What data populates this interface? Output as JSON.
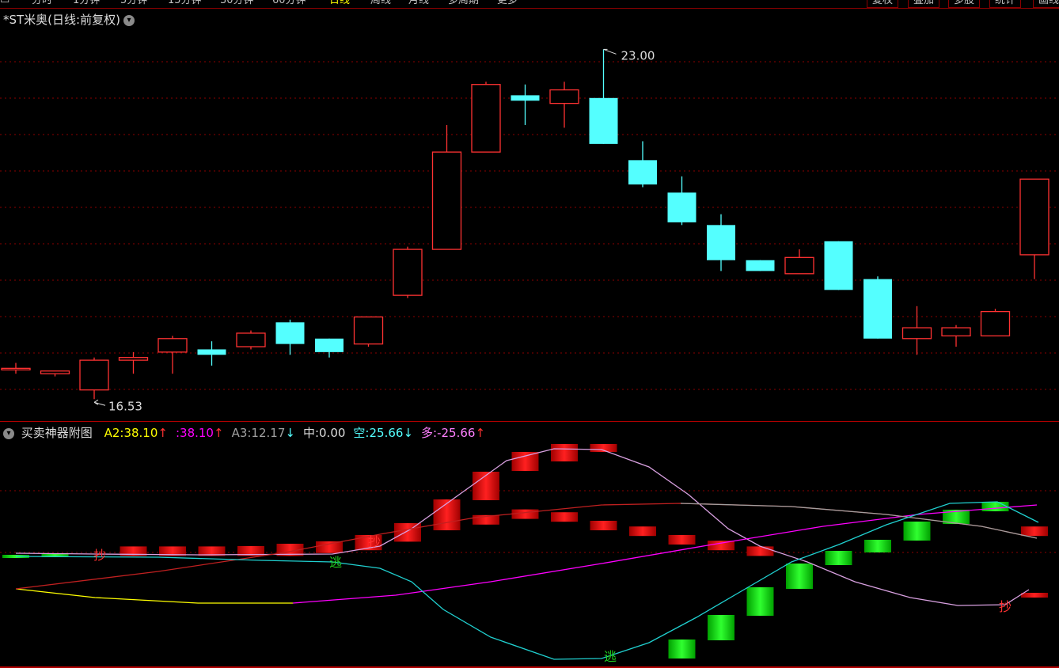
{
  "toolbar": {
    "periods": [
      "分时",
      "1分钟",
      "5分钟",
      "15分钟",
      "30分钟",
      "60分钟",
      "日线",
      "周线",
      "月线",
      "多周期",
      "更多"
    ],
    "active_period": "日线",
    "buttons": [
      "复权",
      "叠加",
      "多股",
      "统计",
      "画线"
    ]
  },
  "main_chart": {
    "title": "*ST米奥(日线:前复权)",
    "high_label": "23.00",
    "low_label": "16.53",
    "colors": {
      "up": "#ff3232",
      "down": "#54ffff",
      "grid": "#8b0000"
    }
  },
  "indicator": {
    "name": "买卖神器附图",
    "items": [
      {
        "label": "A2:",
        "value": "38.10",
        "arrow": "↑",
        "label_color": "#ffff00",
        "value_color": "#ffff00",
        "arrow_color": "#ff3232"
      },
      {
        "label": ":",
        "value": "38.10",
        "arrow": "↑",
        "label_color": "#ff00ff",
        "value_color": "#ff00ff",
        "arrow_color": "#ff3232"
      },
      {
        "label": "A3:",
        "value": "12.17",
        "arrow": "↓",
        "label_color": "#a0a0a0",
        "value_color": "#a0a0a0",
        "arrow_color": "#54ffff"
      },
      {
        "label": "中:",
        "value": "0.00",
        "arrow": "",
        "label_color": "#dcdcdc",
        "value_color": "#dcdcdc",
        "arrow_color": "#dcdcdc"
      },
      {
        "label": "空:",
        "value": "25.66",
        "arrow": "↓",
        "label_color": "#54ffff",
        "value_color": "#54ffff",
        "arrow_color": "#54ffff"
      },
      {
        "label": "多:",
        "value": "-25.66",
        "arrow": "↑",
        "label_color": "#ff80ff",
        "value_color": "#ff80ff",
        "arrow_color": "#ff3232"
      }
    ],
    "signals": {
      "buy": "抄",
      "escape": "逃"
    }
  },
  "chart_data": {
    "type": "candlestick",
    "candles": [
      {
        "o": 17.1,
        "h": 17.2,
        "l": 17.0,
        "c": 17.1
      },
      {
        "o": 17.0,
        "h": 17.05,
        "l": 16.95,
        "c": 17.05
      },
      {
        "o": 16.7,
        "h": 17.3,
        "l": 16.53,
        "c": 17.25
      },
      {
        "o": 17.25,
        "h": 17.4,
        "l": 17.0,
        "c": 17.3
      },
      {
        "o": 17.4,
        "h": 17.7,
        "l": 17.0,
        "c": 17.65
      },
      {
        "o": 17.45,
        "h": 17.6,
        "l": 17.15,
        "c": 17.35
      },
      {
        "o": 17.5,
        "h": 17.8,
        "l": 17.45,
        "c": 17.75
      },
      {
        "o": 17.95,
        "h": 18.0,
        "l": 17.35,
        "c": 17.55
      },
      {
        "o": 17.65,
        "h": 17.65,
        "l": 17.3,
        "c": 17.4
      },
      {
        "o": 17.55,
        "h": 18.05,
        "l": 17.5,
        "c": 18.05
      },
      {
        "o": 18.45,
        "h": 19.35,
        "l": 18.4,
        "c": 19.3
      },
      {
        "o": 19.3,
        "h": 21.6,
        "l": 19.3,
        "c": 21.1
      },
      {
        "o": 21.1,
        "h": 22.4,
        "l": 21.1,
        "c": 22.35
      },
      {
        "o": 22.15,
        "h": 22.35,
        "l": 21.6,
        "c": 22.05
      },
      {
        "o": 22.0,
        "h": 22.4,
        "l": 21.55,
        "c": 22.25
      },
      {
        "o": 22.1,
        "h": 23.0,
        "l": 21.25,
        "c": 21.25
      },
      {
        "o": 20.95,
        "h": 21.3,
        "l": 20.45,
        "c": 20.5
      },
      {
        "o": 20.35,
        "h": 20.65,
        "l": 19.75,
        "c": 19.8
      },
      {
        "o": 19.75,
        "h": 19.95,
        "l": 18.9,
        "c": 19.1
      },
      {
        "o": 19.1,
        "h": 19.1,
        "l": 18.9,
        "c": 18.9
      },
      {
        "o": 18.85,
        "h": 19.3,
        "l": 18.85,
        "c": 19.15
      },
      {
        "o": 19.45,
        "h": 19.45,
        "l": 18.55,
        "c": 18.55
      },
      {
        "o": 18.75,
        "h": 18.8,
        "l": 17.65,
        "c": 17.65
      },
      {
        "o": 17.65,
        "h": 18.25,
        "l": 17.35,
        "c": 17.85
      },
      {
        "o": 17.7,
        "h": 17.9,
        "l": 17.5,
        "c": 17.85
      },
      {
        "o": 17.7,
        "h": 18.2,
        "l": 17.7,
        "c": 18.15
      },
      {
        "o": 19.2,
        "h": 20.1,
        "l": 18.75,
        "c": 20.6
      }
    ],
    "ylim": [
      16.3,
      23.4
    ],
    "indicator_series": {
      "up_bars": [
        0,
        0,
        0,
        1,
        1,
        1,
        1,
        1,
        2,
        3,
        6,
        10,
        12,
        14,
        13,
        10,
        8,
        5,
        3,
        1,
        0,
        0,
        0,
        0,
        0,
        0,
        8
      ],
      "down_bars": [
        1,
        1,
        0,
        0,
        0,
        0,
        0,
        0,
        0,
        0,
        0,
        0,
        0,
        0,
        0,
        0,
        0,
        2,
        8,
        14,
        20,
        25,
        28,
        32,
        35,
        38,
        0
      ]
    }
  }
}
